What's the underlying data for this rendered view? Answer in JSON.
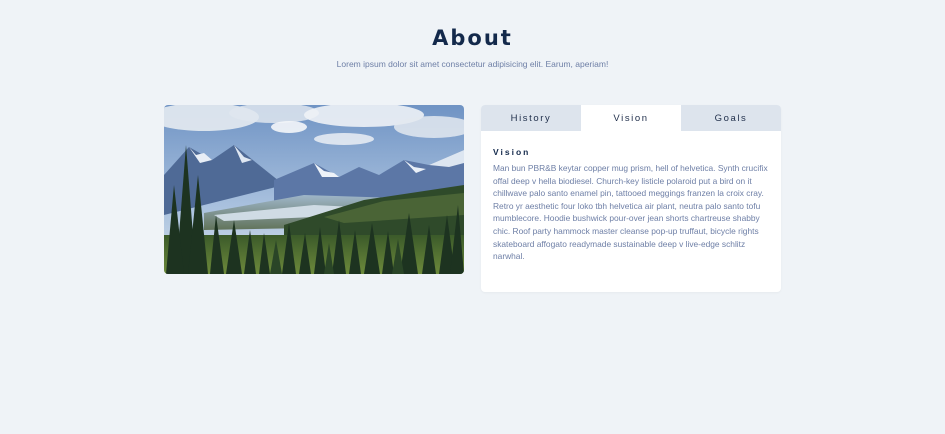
{
  "header": {
    "title": "About",
    "subtitle": "Lorem ipsum dolor sit amet consectetur adipisicing elit. Earum, aperiam!"
  },
  "image": {
    "alt": "Mountain landscape",
    "icon": "landscape-photo"
  },
  "tabs": [
    {
      "label": "History",
      "active": false
    },
    {
      "label": "Vision",
      "active": true
    },
    {
      "label": "Goals",
      "active": false
    }
  ],
  "panel": {
    "heading": "Vision",
    "text": "Man bun PBR&B keytar copper mug prism, hell of helvetica. Synth crucifix offal deep v hella biodiesel. Church-key listicle polaroid put a bird on it chillwave palo santo enamel pin, tattooed meggings franzen la croix cray. Retro yr aesthetic four loko tbh helvetica air plant, neutra palo santo tofu mumblecore. Hoodie bushwick pour-over jean shorts chartreuse shabby chic. Roof party hammock master cleanse pop-up truffaut, bicycle rights skateboard affogato readymade sustainable deep v live-edge schlitz narwhal."
  },
  "colors": {
    "page_bg": "#eff3f7",
    "title": "#13294b",
    "body_text": "#6e7fa6",
    "tab_inactive": "#dde4ed",
    "tab_active": "#ffffff"
  }
}
